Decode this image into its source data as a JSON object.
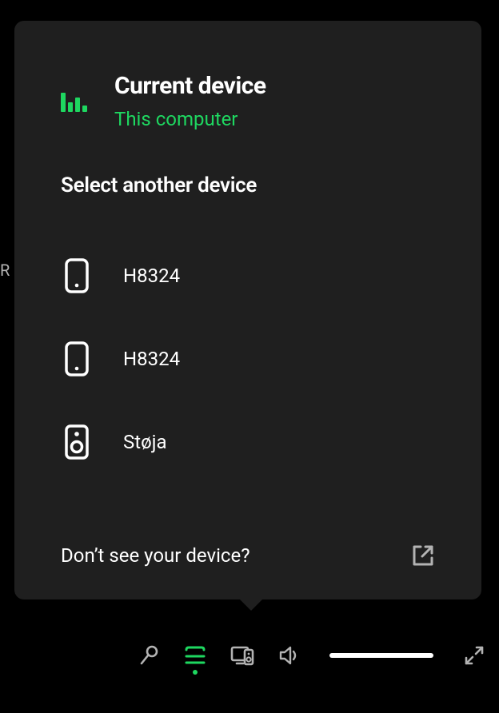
{
  "background": {
    "partial_text": "R"
  },
  "popup": {
    "current_label": "Current device",
    "current_name": "This computer",
    "section_title": "Select another device",
    "devices": [
      {
        "name": "H8324",
        "kind": "phone"
      },
      {
        "name": "H8324",
        "kind": "phone"
      },
      {
        "name": "Støja",
        "kind": "speaker"
      }
    ],
    "help_text": "Don’t see your device?"
  },
  "bottombar": {
    "volume": 100
  }
}
